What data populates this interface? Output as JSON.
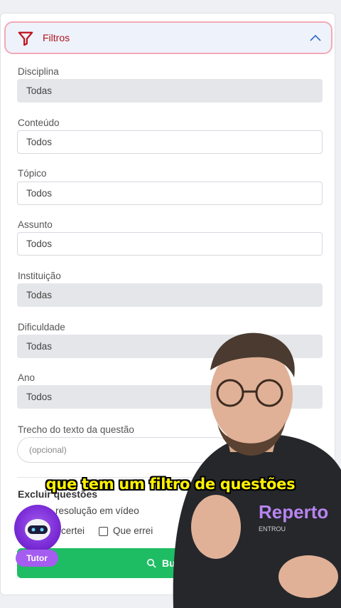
{
  "filters": {
    "header_title": "Filtros",
    "fields": [
      {
        "label": "Disciplina",
        "value": "Todas",
        "disabled": true
      },
      {
        "label": "Conteúdo",
        "value": "Todos",
        "disabled": false
      },
      {
        "label": "Tópico",
        "value": "Todos",
        "disabled": false
      },
      {
        "label": "Assunto",
        "value": "Todos",
        "disabled": false
      },
      {
        "label": "Instituição",
        "value": "Todas",
        "disabled": true
      },
      {
        "label": "Dificuldade",
        "value": "Todas",
        "disabled": true
      },
      {
        "label": "Ano",
        "value": "Todos",
        "disabled": true
      }
    ],
    "text_search": {
      "label": "Trecho do texto da questão",
      "placeholder": "(opcional)"
    },
    "exclude": {
      "title": "Excluir questões",
      "option_video": "resolução em vídeo",
      "option_acertei": "certei",
      "option_errei": "Que errei"
    },
    "search_button_label": "Bu"
  },
  "tutor": {
    "label": "Tutor"
  },
  "video": {
    "caption": "que tem um filtro de questões",
    "shirt_text": "Reperto",
    "shirt_subtext": "ENTROU"
  },
  "colors": {
    "accent_red": "#b3141d",
    "green": "#1fbd63",
    "purple": "#a55cf0",
    "caption_yellow": "#fff200"
  }
}
